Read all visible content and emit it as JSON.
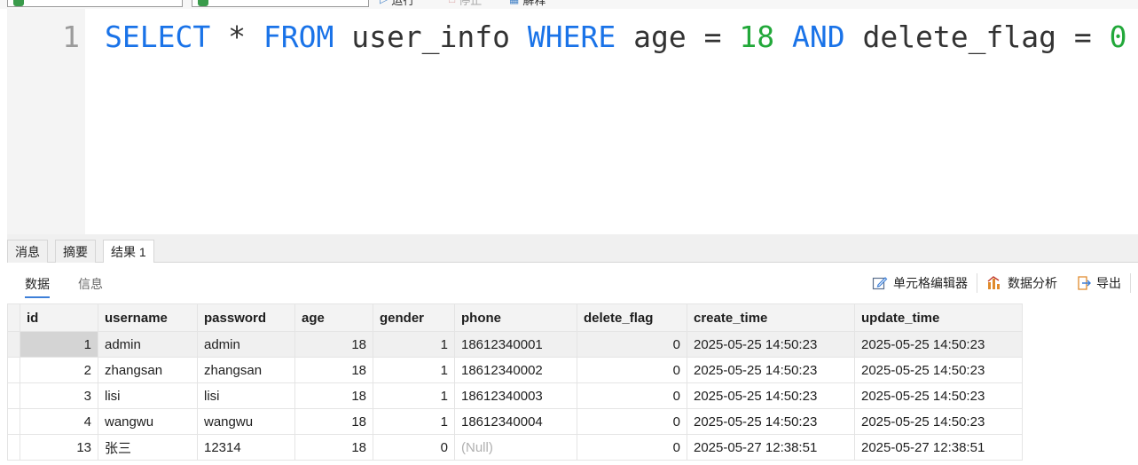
{
  "toolbar": {
    "run_label": "运行",
    "stop_label": "停止",
    "explain_label": "解释"
  },
  "editor": {
    "line_number": "1",
    "tokens": {
      "select": "SELECT",
      "star": "*",
      "from": "FROM",
      "table": "user_info",
      "where": "WHERE",
      "col1": "age",
      "eq1": "=",
      "val1": "18",
      "and": "AND",
      "col2": "delete_flag",
      "eq2": "=",
      "val2": "0"
    }
  },
  "result_tabs": [
    "消息",
    "摘要",
    "结果 1"
  ],
  "active_result_tab": "结果 1",
  "sub_tabs": {
    "data": "数据",
    "info": "信息"
  },
  "tools": {
    "cell_editor": "单元格编辑器",
    "data_analysis": "数据分析",
    "export": "导出"
  },
  "table": {
    "columns": [
      "id",
      "username",
      "password",
      "age",
      "gender",
      "phone",
      "delete_flag",
      "create_time",
      "update_time"
    ],
    "rows": [
      [
        "1",
        "admin",
        "admin",
        "18",
        "1",
        "18612340001",
        "0",
        "2025-05-25 14:50:23",
        "2025-05-25 14:50:23"
      ],
      [
        "2",
        "zhangsan",
        "zhangsan",
        "18",
        "1",
        "18612340002",
        "0",
        "2025-05-25 14:50:23",
        "2025-05-25 14:50:23"
      ],
      [
        "3",
        "lisi",
        "lisi",
        "18",
        "1",
        "18612340003",
        "0",
        "2025-05-25 14:50:23",
        "2025-05-25 14:50:23"
      ],
      [
        "4",
        "wangwu",
        "wangwu",
        "18",
        "1",
        "18612340004",
        "0",
        "2025-05-25 14:50:23",
        "2025-05-25 14:50:23"
      ],
      [
        "13",
        "张三",
        "12314",
        "18",
        "0",
        "(Null)",
        "0",
        "2025-05-27 12:38:51",
        "2025-05-27 12:38:51"
      ]
    ]
  },
  "colors": {
    "keyword": "#1a73e8",
    "number": "#22a83a",
    "tab_underline": "#3d7fd8"
  }
}
